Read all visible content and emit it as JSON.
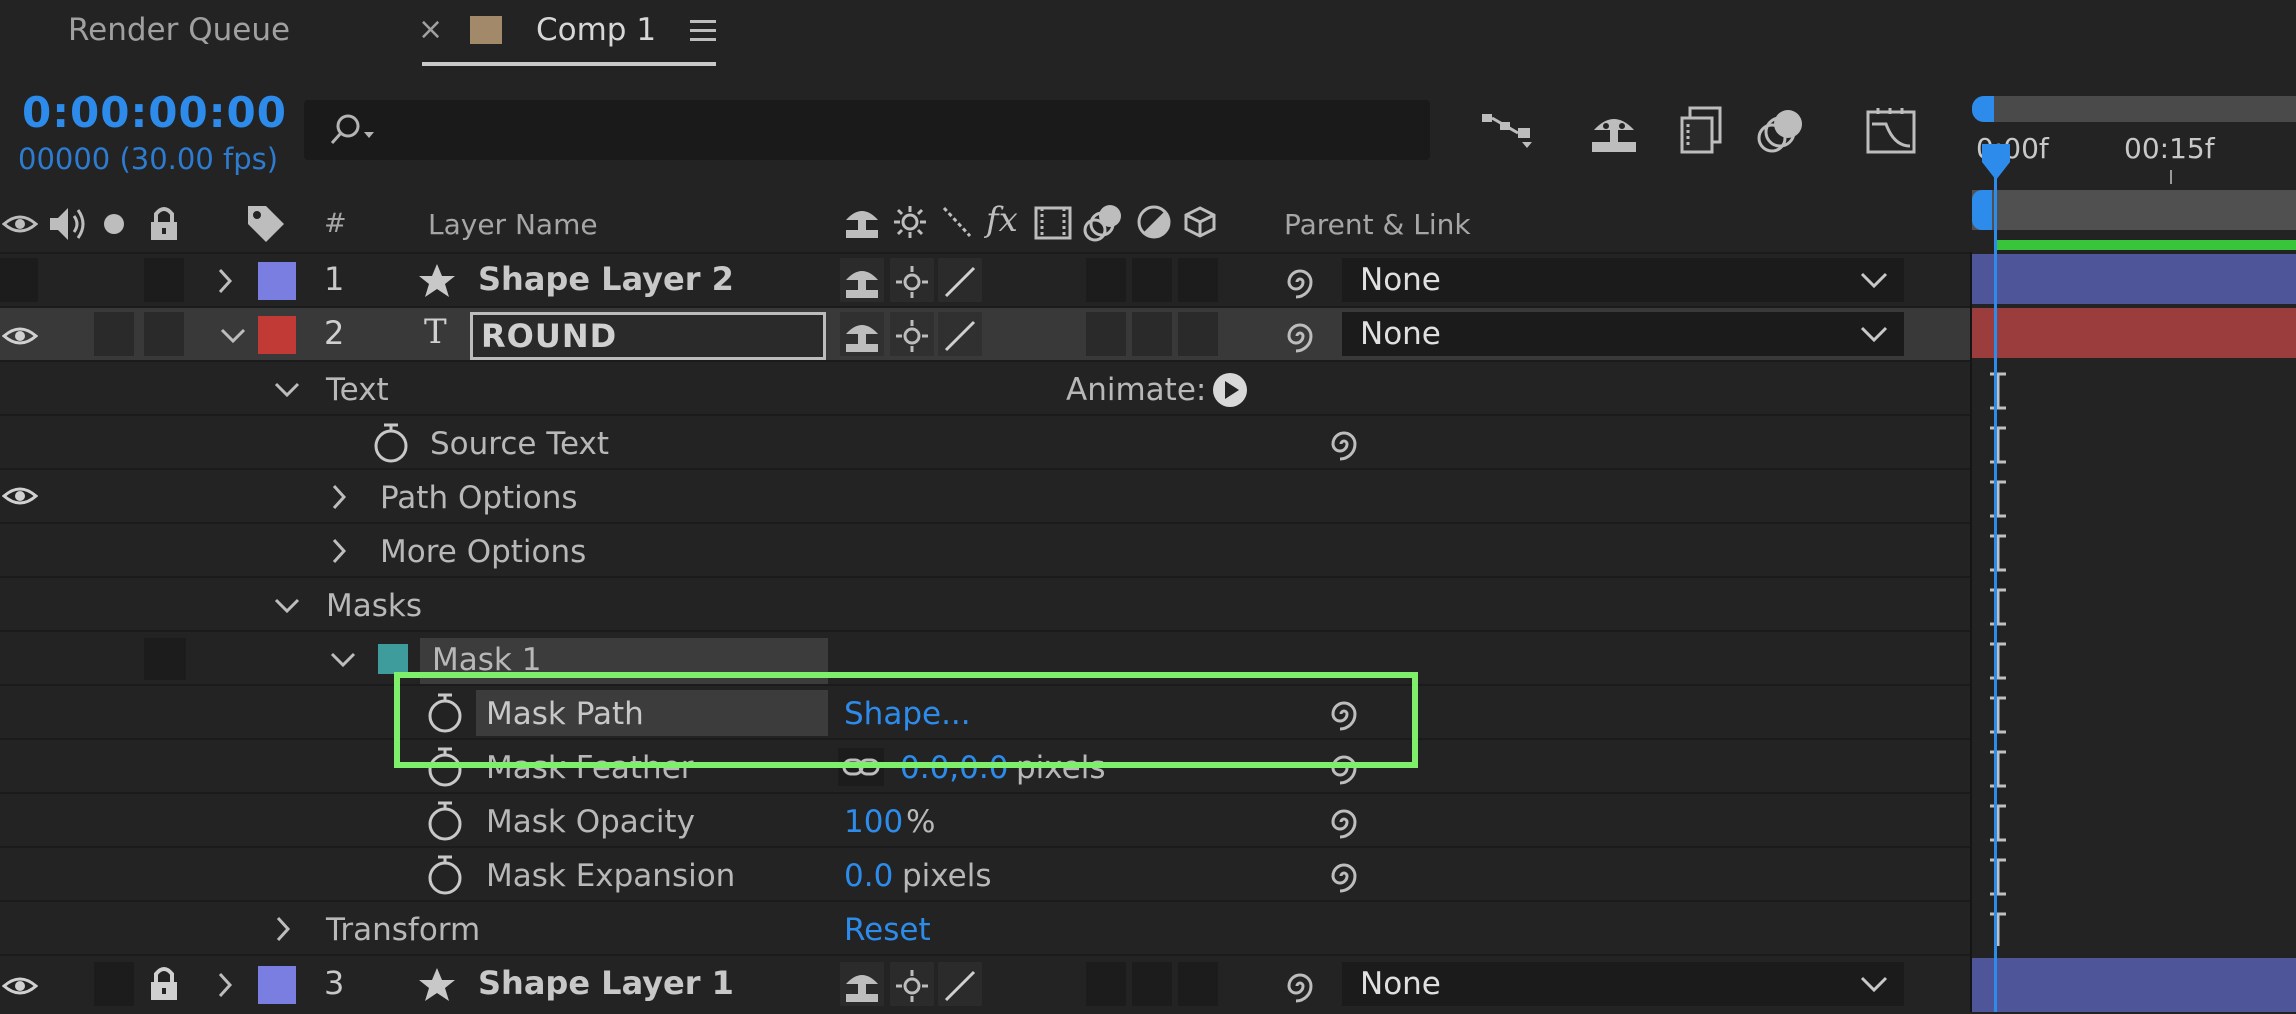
{
  "tabs": {
    "render_queue": "Render Queue",
    "close_glyph": "×",
    "comp_tab": "Comp 1",
    "comp_tab_color": "#a1896a"
  },
  "time": {
    "timecode": "0:00:00:00",
    "frames": "00000 (30.00 fps)"
  },
  "search": {
    "value": "",
    "icon": "search-icon"
  },
  "toolbar_icons": [
    "flowchart-icon",
    "shy-icon",
    "frame-blending-icon",
    "motion-blur-icon",
    "graph-editor-icon"
  ],
  "ruler": {
    "tick_0": "0:00f",
    "tick_15": "00:15f"
  },
  "columns": {
    "number": "#",
    "layer_name": "Layer Name",
    "parent": "Parent & Link"
  },
  "layers": [
    {
      "num": "1",
      "name": "Shape Layer 2",
      "type_icon": "star-icon",
      "label_color": "#7a7ee0",
      "parent": "None"
    },
    {
      "num": "2",
      "name": "ROUND",
      "type_icon": "text-layer-icon",
      "type_glyph": "T",
      "label_color": "#c13a36",
      "parent": "None"
    },
    {
      "num": "3",
      "name": "Shape Layer 1",
      "type_icon": "star-icon",
      "label_color": "#7a7ee0",
      "parent": "None"
    }
  ],
  "props": {
    "text_group": "Text",
    "animate": "Animate:",
    "source_text": "Source Text",
    "path_options": "Path Options",
    "more_options": "More Options",
    "masks": "Masks",
    "mask1": "Mask 1",
    "mask1_color": "#3e9c9c",
    "mask_path": "Mask Path",
    "mask_path_value": "Shape...",
    "mask_feather": "Mask Feather",
    "mask_feather_value": "0.0,0.0",
    "mask_feather_unit": "pixels",
    "mask_opacity": "Mask Opacity",
    "mask_opacity_value": "100",
    "mask_opacity_unit": "%",
    "mask_expansion": "Mask Expansion",
    "mask_expansion_value": "0.0",
    "mask_expansion_unit": "pixels",
    "transform": "Transform",
    "transform_reset": "Reset"
  },
  "colors": {
    "accent_blue": "#2d8ceb",
    "highlight_green": "#7fee6a",
    "bar_purple": "#4f5599",
    "bar_red": "#9c3d3d"
  }
}
